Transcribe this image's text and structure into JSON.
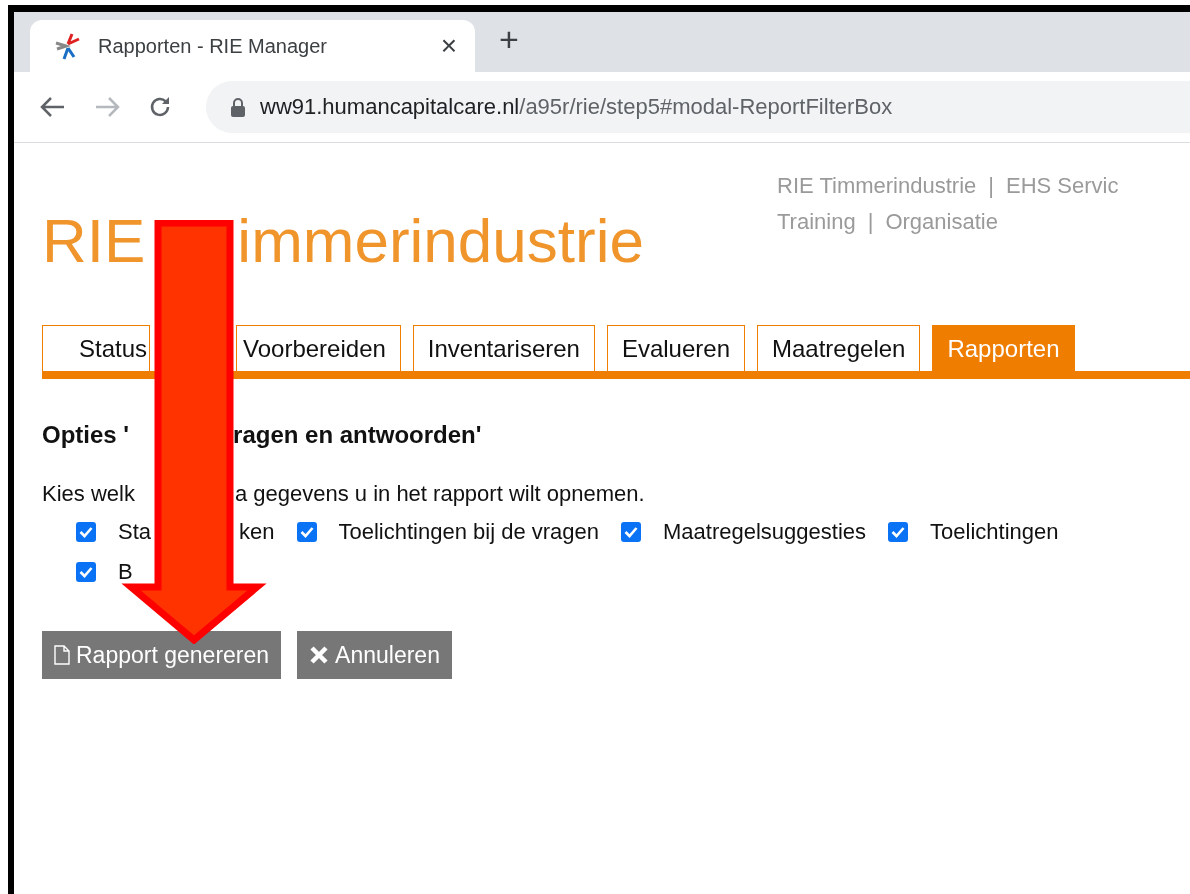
{
  "browser": {
    "tab_title": "Rapporten - RIE Manager",
    "close": "×",
    "new_tab": "+",
    "url_host": "ww91.humancapitalcare.nl",
    "url_path": "/a95r/rie/step5#modal-ReportFilterBox"
  },
  "logo": [
    "RIE",
    "immerindustrie"
  ],
  "header_links": [
    [
      "RIE Timmerindustrie",
      "|",
      "EHS Servic"
    ],
    [
      "Training",
      "|",
      "Organisatie"
    ]
  ],
  "tabs": [
    {
      "label": "Status",
      "selected": false
    },
    {
      "label": "Voorbereiden",
      "selected": false
    },
    {
      "label": "Inventariseren",
      "selected": false
    },
    {
      "label": "Evalueren",
      "selected": false
    },
    {
      "label": "Maatregelen",
      "selected": false
    },
    {
      "label": "Rapporten",
      "selected": true
    }
  ],
  "heading": [
    "Opties '",
    "ragen en antwoorden'"
  ],
  "intro": [
    "Kies welk",
    "a gegevens u in het rapport wilt opnemen."
  ],
  "option_rows": [
    [
      {
        "parts": [
          "Sta",
          "ken"
        ],
        "checked": true
      },
      {
        "parts": [
          "Toelichtingen bij de vragen"
        ],
        "checked": true
      },
      {
        "parts": [
          "Maatregelsuggesties"
        ],
        "checked": true
      },
      {
        "parts": [
          "Toelichtingen"
        ],
        "checked": true
      }
    ],
    [
      {
        "parts": [
          "B"
        ],
        "checked": true
      }
    ]
  ],
  "buttons": [
    {
      "kind": "generate",
      "label": "Rapport genereren"
    },
    {
      "kind": "cancel",
      "label": "Annuleren"
    }
  ]
}
